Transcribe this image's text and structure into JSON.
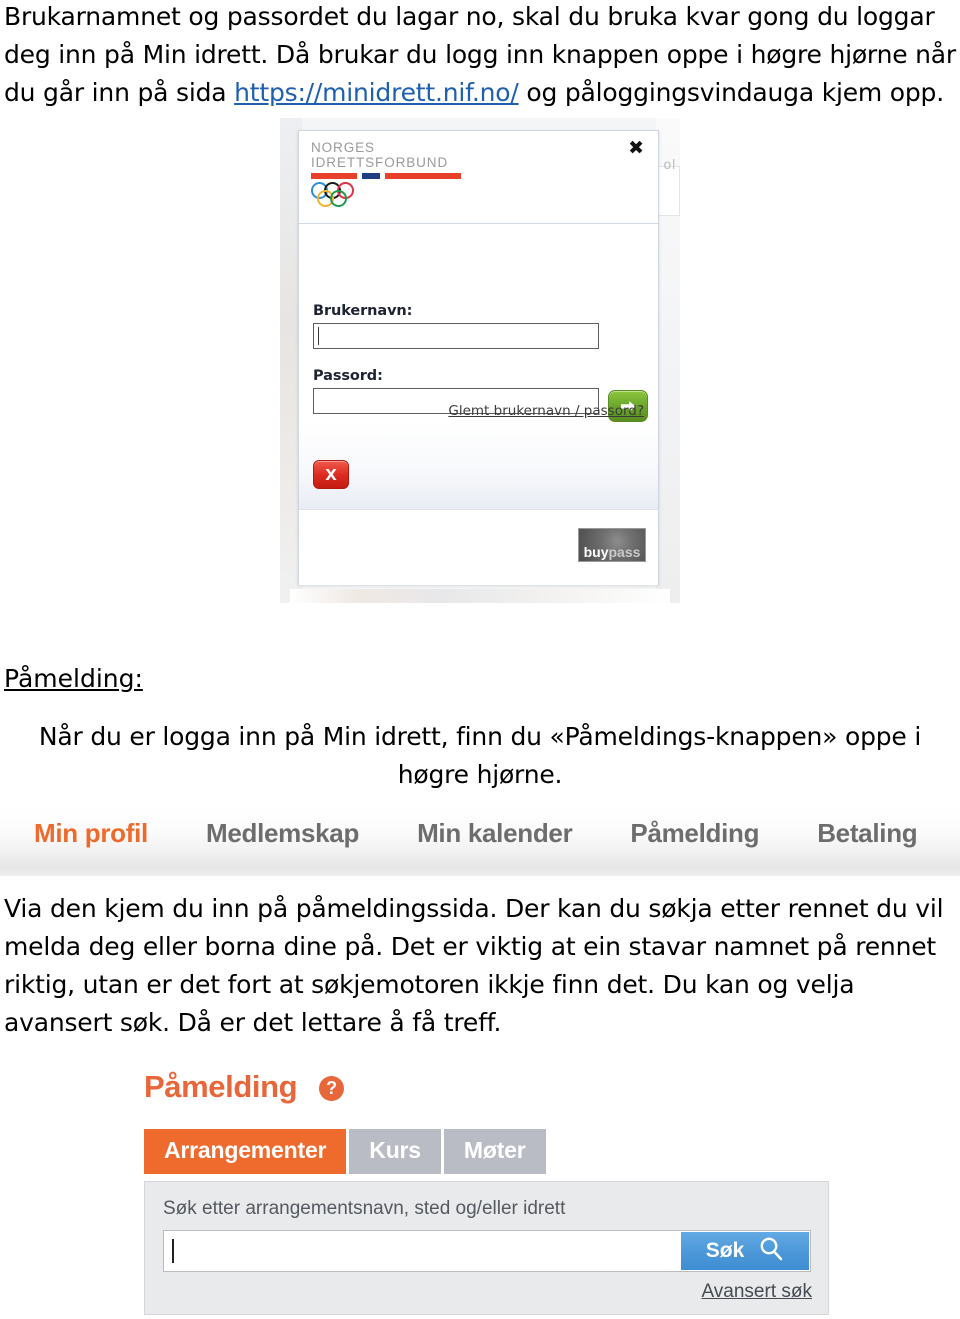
{
  "document": {
    "paragraph_1_part1": "Brukarnamnet og passordet du lagar no, skal du bruka kvar gong du loggar deg inn på Min idrett. Då brukar du logg inn knappen oppe i høgre hjørne når du går inn på sida ",
    "paragraph_1_link": "https://minidrett.nif.no/",
    "paragraph_1_part2": " og påloggingsvindauga kjem opp.",
    "heading_pamelding": "Påmelding:",
    "paragraph_2": "Når du er logga inn på Min idrett, finn du «Påmeldings-knappen» oppe i høgre hjørne.",
    "paragraph_3": "Via den kjem du inn på påmeldingssida. Der kan du søkja etter rennet du vil melda deg eller borna dine på. Det er viktig at ein stavar namnet på rennet riktig, utan er det fort at søkjemotoren ikkje finn det. Du kan og velja avansert søk. Då er det lettare å få treff."
  },
  "login_dialog": {
    "logo_line1": "NORGES",
    "logo_line2": "IDRETTSFORBUND",
    "close_icon": "✖",
    "username_label": "Brukernavn:",
    "username_value": "",
    "password_label": "Passord:",
    "password_value": "",
    "forgot_link": "Glemt brukernavn / passord?",
    "cancel_label": "X",
    "submit_icon": "arrow-right-icon",
    "buypass_part1": "buy",
    "buypass_part2": "pass",
    "background_text": "ol",
    "accent_red": "#e8402a",
    "accent_blue": "#1b3f82",
    "submit_green": "#6aa32a",
    "cancel_red": "#dc2b20"
  },
  "nav_bar": {
    "items": [
      {
        "label": "Min profil",
        "active": true
      },
      {
        "label": "Medlemskap",
        "active": false
      },
      {
        "label": "Min kalender",
        "active": false
      },
      {
        "label": "Påmelding",
        "active": false
      },
      {
        "label": "Betaling",
        "active": false
      }
    ],
    "active_color": "#ed6a2c",
    "inactive_color": "#6d6d6d"
  },
  "pamelding_widget": {
    "title": "Påmelding",
    "help_icon": "?",
    "tabs": [
      {
        "label": "Arrangementer",
        "active": true
      },
      {
        "label": "Kurs",
        "active": false
      },
      {
        "label": "Møter",
        "active": false
      }
    ],
    "search_label": "Søk etter arrangementsnavn, sted og/eller idrett",
    "search_value": "",
    "search_button": "Søk",
    "search_icon": "magnifier-icon",
    "advanced_link": "Avansert søk",
    "accent_orange": "#ee6a2d",
    "button_blue": "#4b97d8"
  }
}
